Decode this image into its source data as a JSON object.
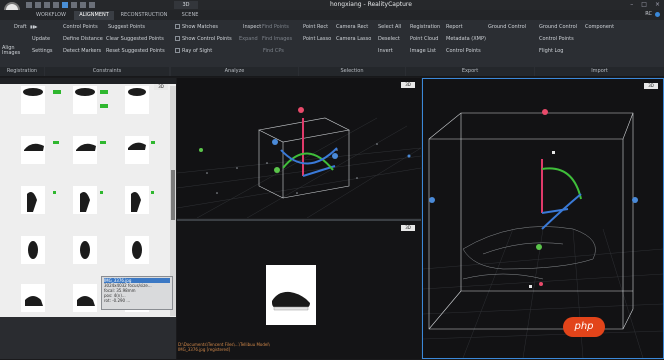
{
  "window": {
    "title": "hongxiang - RealityCapture",
    "mode_button": "3D",
    "controls": [
      "–",
      "□",
      "×"
    ]
  },
  "tabs": [
    {
      "label": "WORKFLOW"
    },
    {
      "label": "ALIGNMENT"
    },
    {
      "label": "RECONSTRUCTION"
    },
    {
      "label": "SCENE"
    }
  ],
  "topright": {
    "label": "RC"
  },
  "ribbon": {
    "registration": {
      "items": [
        "Draft",
        "Update",
        "Align Images",
        "Settings"
      ],
      "group": "Registration"
    },
    "constraints": {
      "items": [
        "Control Points",
        "Suggest Points",
        "Define Distance",
        "Clear Suggested Points",
        "Detect Markers",
        "Reset Suggested Points"
      ],
      "group": "Constraints"
    },
    "analyze": {
      "items": [
        "Show Matches",
        "Inspect",
        "Find Points",
        "Show Control Points",
        "Expand",
        "Find Images",
        "Ray of Sight",
        "Find CPs"
      ],
      "group": "Analyze"
    },
    "selection": {
      "items": [
        "Point Rect",
        "Camera Rect",
        "Point Lasso",
        "Camera Lasso"
      ],
      "group": "Selection"
    },
    "misc": {
      "items": [
        "Select All",
        "Deselect",
        "Invert"
      ]
    },
    "export": {
      "items": [
        "Registration",
        "Report",
        "Ground Control",
        "Point Cloud",
        "Metadata (XMP)",
        "Image List",
        "Control Points"
      ],
      "group": "Export"
    },
    "import": {
      "items": [
        "Ground Control",
        "Component",
        "Control Points",
        "Flight Log"
      ],
      "group": "Import"
    }
  },
  "left_panel": {
    "tooltip": {
      "filename": "IMG_3376.jpg",
      "lines": [
        "3024x4032 focus/size...",
        "focal: 35.98mm",
        "pos: 4(n)...",
        "rot: -0.290 ..."
      ]
    }
  },
  "viewports": {
    "tag": "3D",
    "path": "D:\\Documents\\Tencent Files\\...\\Tellibuu Model\\",
    "path2": "IMG_3376.jpg [registered]"
  },
  "watermark": {
    "label": "php"
  }
}
